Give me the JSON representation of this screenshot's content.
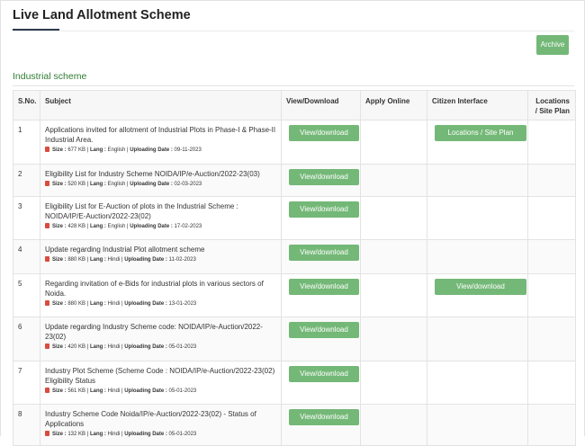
{
  "page": {
    "title": "Live Land Allotment Scheme",
    "archive_label": "Archive"
  },
  "section": {
    "title": "Industrial scheme"
  },
  "table": {
    "headers": {
      "sno": "S.No.",
      "subject": "Subject",
      "view": "View/Download",
      "apply": "Apply Online",
      "citizen": "Citizen Interface",
      "locations": "Locations / Site Plan"
    },
    "rows": [
      {
        "sno": "1",
        "subject": "Applications invited for allotment of Industrial Plots in Phase-I & Phase-II Industrial Area.",
        "size_label": "Size :",
        "size": "677 KB",
        "lang_label": "Lang :",
        "lang": "English",
        "date_label": "Uploading Date :",
        "date": "09-11-2023",
        "view_label": "View/download",
        "citizen_label": "Locations / Site Plan"
      },
      {
        "sno": "2",
        "subject": "Eligibility List for Industry Scheme NOIDA/IP/e-Auction/2022-23(03)",
        "size_label": "Size :",
        "size": "520 KB",
        "lang_label": "Lang :",
        "lang": "English",
        "date_label": "Uploading Date :",
        "date": "02-03-2023",
        "view_label": "View/download"
      },
      {
        "sno": "3",
        "subject": "Eligibility List for E-Auction of plots in the Industrial Scheme : NOIDA/IP/E-Auction/2022-23(02)",
        "size_label": "Size :",
        "size": "428 KB",
        "lang_label": "Lang :",
        "lang": "English",
        "date_label": "Uploading Date :",
        "date": "17-02-2023",
        "view_label": "View/download"
      },
      {
        "sno": "4",
        "subject": "Update regarding Industrial Plot allotment scheme",
        "size_label": "Size :",
        "size": "880 KB",
        "lang_label": "Lang :",
        "lang": "Hindi",
        "date_label": "Uploading Date :",
        "date": "11-02-2023",
        "view_label": "View/download"
      },
      {
        "sno": "5",
        "subject": "Regarding invitation of e-Bids for industrial plots in various sectors of Noida.",
        "size_label": "Size :",
        "size": "880 KB",
        "lang_label": "Lang :",
        "lang": "Hindi",
        "date_label": "Uploading Date :",
        "date": "13-01-2023",
        "view_label": "View/download",
        "citizen_label": "View/download"
      },
      {
        "sno": "6",
        "subject": "Update regarding Industry Scheme code: NOIDA/IP/e-Auction/2022-23(02)",
        "size_label": "Size :",
        "size": "420 KB",
        "lang_label": "Lang :",
        "lang": "Hindi",
        "date_label": "Uploading Date :",
        "date": "05-01-2023",
        "view_label": "View/download"
      },
      {
        "sno": "7",
        "subject": "Industry Plot Scheme (Scheme Code : NOIDA/IP/e-Auction/2022-23(02) Eligibility Status",
        "size_label": "Size :",
        "size": "561 KB",
        "lang_label": "Lang :",
        "lang": "Hindi",
        "date_label": "Uploading Date :",
        "date": "05-01-2023",
        "view_label": "View/download"
      },
      {
        "sno": "8",
        "subject": "Industry Scheme Code Noida/IP/e-Auction/2022-23(02) - Status of Applications",
        "size_label": "Size :",
        "size": "132 KB",
        "lang_label": "Lang :",
        "lang": "Hindi",
        "date_label": "Uploading Date :",
        "date": "05-01-2023",
        "view_label": "View/download"
      }
    ]
  },
  "colors": {
    "button_green": "#74b877",
    "section_green": "#2e7d32",
    "pdf_icon": "#d94c3d"
  }
}
